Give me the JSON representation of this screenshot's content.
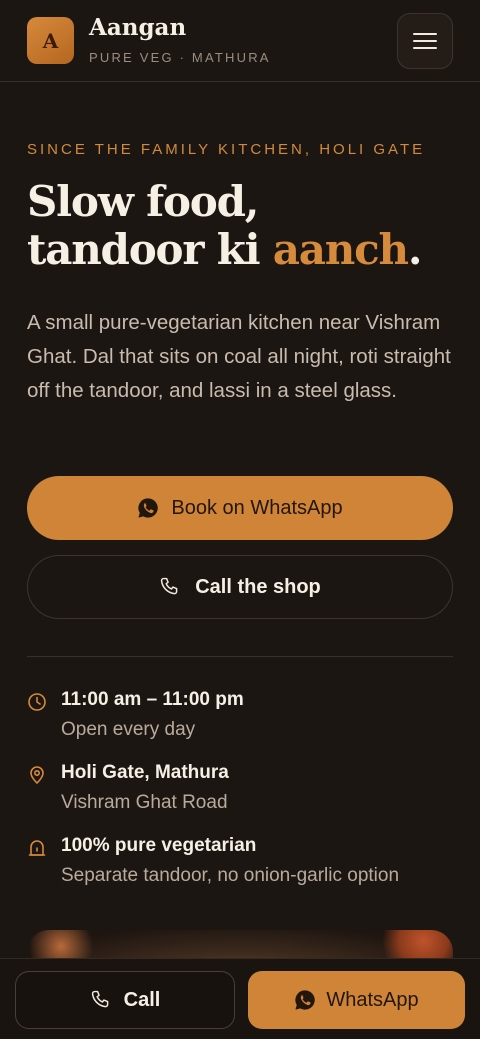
{
  "header": {
    "logo_letter": "A",
    "brand_name": "Aangan",
    "brand_sub": "PURE VEG · MATHURA",
    "menu_icon": "hamburger-icon"
  },
  "hero": {
    "eyebrow": "SINCE THE FAMILY KITCHEN, HOLI GATE",
    "headline_line1": "Slow food,",
    "headline_line2_prefix": "tandoor ki ",
    "headline_accent": "aanch",
    "headline_suffix": ".",
    "lede": "A small pure-vegetarian kitchen near Vishram Ghat. Dal that sits on coal all night, roti straight off the tandoor, and lassi in a steel glass."
  },
  "actions": {
    "primary_label": "Book on WhatsApp",
    "secondary_label": "Call the shop"
  },
  "info": [
    {
      "icon": "clock-icon",
      "title": "11:00 am – 11:00 pm",
      "subtitle": "Open every day"
    },
    {
      "icon": "location-pin-icon",
      "title": "Holi Gate, Mathura",
      "subtitle": "Vishram Ghat Road"
    },
    {
      "icon": "bell-icon",
      "title": "100% pure vegetarian",
      "subtitle": "Separate tandoor, no onion-garlic option"
    }
  ],
  "bottom_bar": {
    "call_label": "Call",
    "whatsapp_label": "WhatsApp"
  },
  "colors": {
    "background": "#1c1612",
    "accent": "#cf8438",
    "text": "#f3ebe0",
    "muted": "#b8ab9c"
  }
}
